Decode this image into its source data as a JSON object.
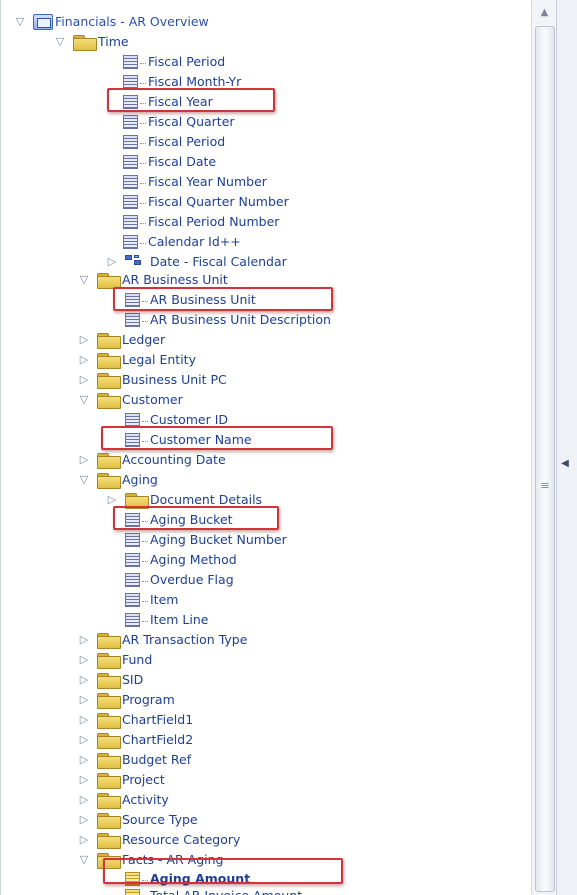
{
  "tree": {
    "root": "Financials - AR Overview",
    "time": {
      "label": "Time",
      "items": [
        "Fiscal Period",
        "Fiscal Month-Yr",
        "Fiscal Year",
        "Fiscal Quarter",
        "Fiscal Period",
        "Fiscal Date",
        "Fiscal Year Number",
        "Fiscal Quarter Number",
        "Fiscal Period Number",
        "Calendar Id++"
      ],
      "hierarchy": "Date - Fiscal Calendar"
    },
    "ar_business_unit": {
      "label": "AR Business Unit",
      "items": [
        "AR Business Unit",
        "AR Business Unit Description"
      ]
    },
    "ledger": "Ledger",
    "legal_entity": "Legal Entity",
    "business_unit_pc": "Business Unit PC",
    "customer": {
      "label": "Customer",
      "items": [
        "Customer ID",
        "Customer Name"
      ]
    },
    "accounting_date": "Accounting Date",
    "aging": {
      "label": "Aging",
      "document_details": "Document Details",
      "items": [
        "Aging Bucket",
        "Aging Bucket Number",
        "Aging Method",
        "Overdue Flag",
        "Item",
        "Item Line"
      ]
    },
    "folders": [
      "AR Transaction Type",
      "Fund",
      "SID",
      "Program",
      "ChartField1",
      "ChartField2",
      "Budget Ref",
      "Project",
      "Activity",
      "Source Type",
      "Resource Category"
    ],
    "facts": {
      "label": "Facts - AR Aging",
      "items": [
        "Aging Amount",
        "Total AR Invoice Amount"
      ]
    }
  },
  "icons": {
    "expanded": "triangle-down-icon",
    "collapsed": "triangle-right-icon",
    "folder": "folder-icon",
    "column": "column-icon",
    "hierarchy": "hierarchy-icon",
    "highlight_color": "#d0333a"
  }
}
